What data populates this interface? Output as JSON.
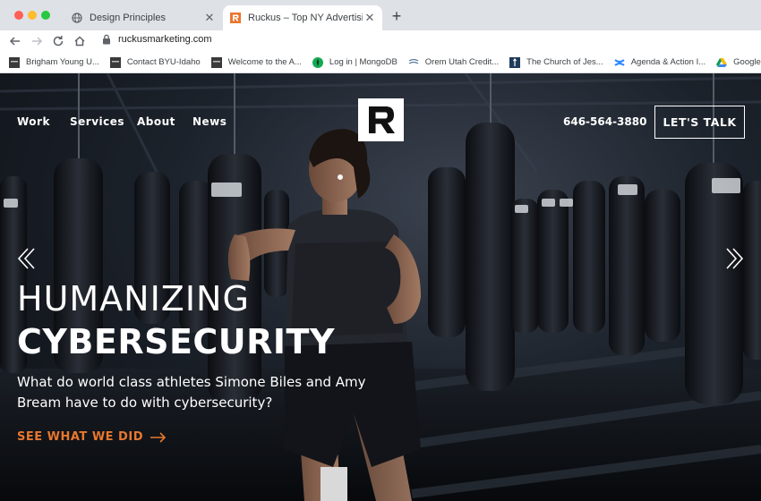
{
  "browser": {
    "tabs": [
      {
        "title": "Design Principles",
        "favicon": "globe-icon",
        "active": false
      },
      {
        "title": "Ruckus – Top NY Advertising &",
        "favicon": "ruckus-favicon",
        "active": true
      }
    ],
    "new_tab_label": "+",
    "close_label": "✕",
    "url": "ruckusmarketing.com",
    "bookmarks": [
      {
        "label": "Brigham Young U...",
        "icon": "byu-icon"
      },
      {
        "label": "Contact BYU-Idaho",
        "icon": "byui-icon"
      },
      {
        "label": "Welcome to the A...",
        "icon": "byu-icon"
      },
      {
        "label": "Log in | MongoDB",
        "icon": "mongodb-leaf-icon"
      },
      {
        "label": "Orem Utah Credit...",
        "icon": "credit-union-icon"
      },
      {
        "label": "The Church of Jes...",
        "icon": "church-icon"
      },
      {
        "label": "Agenda & Action I...",
        "icon": "confluence-icon"
      },
      {
        "label": "Google Dri",
        "icon": "google-drive-icon"
      }
    ]
  },
  "site": {
    "nav": [
      "Work",
      "Services",
      "About",
      "News"
    ],
    "logo_letter": "R",
    "phone": "646-564-3880",
    "cta_label": "LET'S TALK",
    "headline_light": "HUMANIZING",
    "headline_bold": "CYBERSECURITY",
    "subtext": "What do world class athletes Simone Biles and Amy Bream have to do with cybersecurity?",
    "link_label": "SEE WHAT WE DID",
    "colors": {
      "accent": "#e8772e",
      "text": "#ffffff"
    }
  }
}
